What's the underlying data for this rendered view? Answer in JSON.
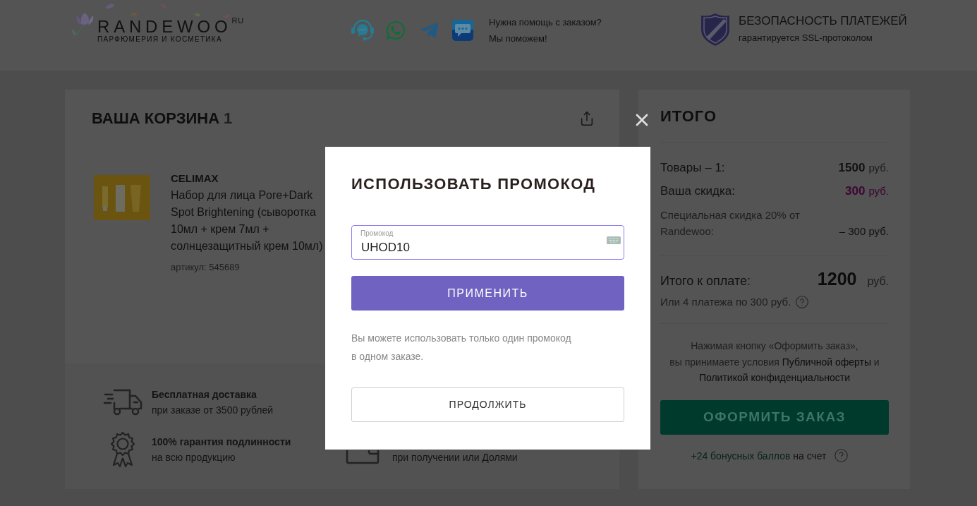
{
  "header": {
    "logo": {
      "name": "RANDEWOO",
      "suffix": "RU",
      "tagline": "ПАРФЮМЕРИЯ И КОСМЕТИКА"
    },
    "help": {
      "title": "Нужна помощь с заказом?",
      "subtitle": "Мы поможем!"
    },
    "security": {
      "title": "БЕЗОПАСНОСТЬ ПЛАТЕЖЕЙ",
      "subtitle": "гарантируется SSL-протоколом"
    }
  },
  "cart": {
    "title": "ВАША КОРЗИНА",
    "count": "1",
    "items": [
      {
        "brand": "CELIMAX",
        "name": "Набор для лица Pore+Dark Spot Brightening (сыворотка 10мл + крем 7мл + солнцезащитный крем 10мл)",
        "article": "артикул: 545689"
      }
    ]
  },
  "features": {
    "column_1": [
      {
        "title": "Бесплатная доставка",
        "subtitle": "при заказе от 3500 рублей"
      },
      {
        "title": "100% гарантия подлинности",
        "subtitle": "на всю продукцию"
      }
    ],
    "column_2": [
      {
        "subtitle": "при получении или Долями"
      }
    ]
  },
  "summary": {
    "title": "ИТОГО",
    "rows": [
      {
        "kind": "plain",
        "label": "Товары – 1:",
        "amount": "1500",
        "currency": "руб."
      },
      {
        "kind": "discount",
        "label": "Ваша скидка:",
        "amount": "300",
        "currency": "руб."
      }
    ],
    "special_discount": {
      "label": "Специальная скидка 20% от Randewoo:",
      "amount": "– 300 руб."
    },
    "total": {
      "label": "Итого к оплате:",
      "amount": "1200",
      "currency": "руб."
    },
    "installments": "Или 4 платежа по 300 руб.",
    "terms": {
      "intro": "Нажимая кнопку «Оформить заказ»,",
      "conditions": "вы принимаете условия",
      "offer_link": "Публичной оферты",
      "between": "и",
      "privacy_link": "Политикой конфиденциальности"
    },
    "checkout_button": "ОФОРМИТЬ ЗАКАЗ",
    "bonus": {
      "link": "+24 бонусных баллов",
      "text": "на счет"
    }
  },
  "promo_dialog": {
    "title": "ИСПОЛЬЗОВАТЬ ПРОМОКОД",
    "field": {
      "label": "Промокод",
      "value": "UHOD10"
    },
    "apply_button": "ПРИМЕНИТЬ",
    "note": "Вы можете использовать только один промокод в одном заказе.",
    "continue_button": "ПРОДОЛЖИТЬ"
  }
}
